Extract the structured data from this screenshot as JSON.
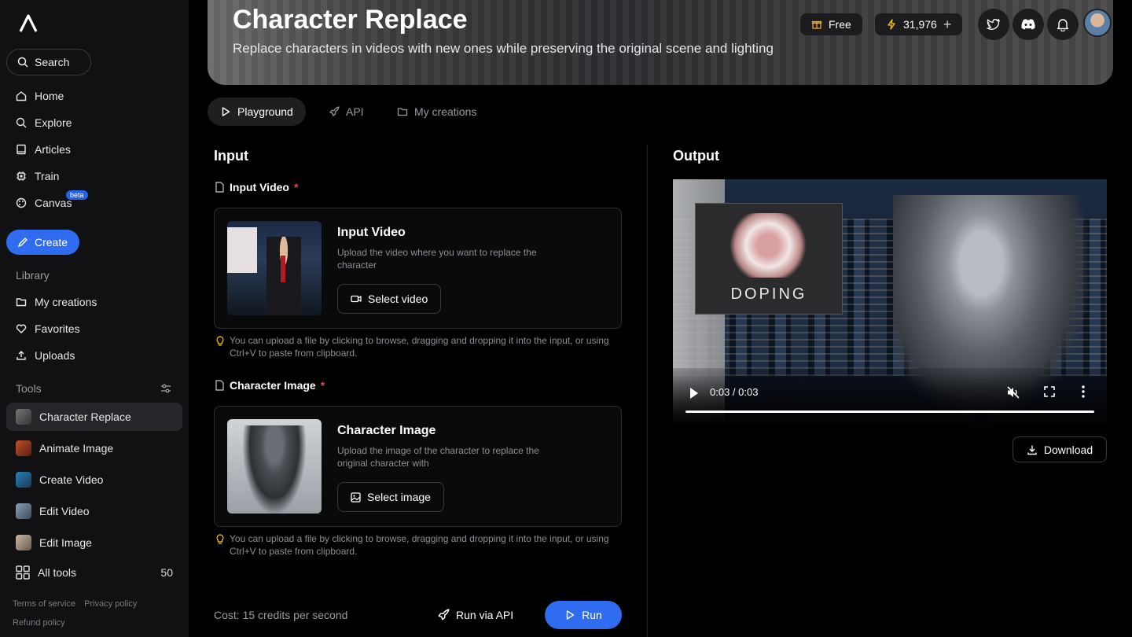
{
  "sidebar": {
    "search_label": "Search",
    "nav": [
      {
        "label": "Home",
        "icon": "home-icon"
      },
      {
        "label": "Explore",
        "icon": "search-icon"
      },
      {
        "label": "Articles",
        "icon": "book-icon"
      },
      {
        "label": "Train",
        "icon": "chip-icon"
      },
      {
        "label": "Canvas",
        "icon": "palette-icon"
      }
    ],
    "canvas_badge": "beta",
    "create_label": "Create",
    "library_label": "Library",
    "library": [
      {
        "label": "My creations",
        "icon": "folder-icon"
      },
      {
        "label": "Favorites",
        "icon": "heart-icon"
      },
      {
        "label": "Uploads",
        "icon": "upload-icon"
      }
    ],
    "tools_label": "Tools",
    "tools": [
      {
        "label": "Character Replace",
        "active": true
      },
      {
        "label": "Animate Image",
        "active": false
      },
      {
        "label": "Create Video",
        "active": false
      },
      {
        "label": "Edit Video",
        "active": false
      },
      {
        "label": "Edit Image",
        "active": false
      }
    ],
    "all_tools_label": "All tools",
    "all_tools_count": "50",
    "footer": {
      "terms": "Terms of service",
      "privacy": "Privacy policy",
      "refund": "Refund policy"
    }
  },
  "header": {
    "title": "Character Replace",
    "subtitle": "Replace characters in videos with new ones while preserving the original scene and lighting",
    "plan_label": "Free",
    "credits": "31,976",
    "credits_add": "+"
  },
  "tabs": [
    {
      "label": "Playground",
      "active": true
    },
    {
      "label": "API",
      "active": false
    },
    {
      "label": "My creations",
      "active": false
    }
  ],
  "input": {
    "heading": "Input",
    "video_field": {
      "label": "Input Video",
      "required_mark": "*",
      "title": "Input Video",
      "desc": "Upload the video where you want to replace the character",
      "button": "Select video"
    },
    "image_field": {
      "label": "Character Image",
      "required_mark": "*",
      "title": "Character Image",
      "desc": "Upload the image of the character to replace the original character with",
      "button": "Select image"
    },
    "hint": "You can upload a file by clicking to browse, dragging and dropping it into the input, or using Ctrl+V to paste from clipboard.",
    "cost": "Cost: 15 credits per second",
    "run_api_label": "Run via API",
    "run_label": "Run"
  },
  "output": {
    "heading": "Output",
    "video_time": "0:03 / 0:03",
    "video_progress": 1.0,
    "thumb_text": "DOPING",
    "download_label": "Download"
  },
  "colors": {
    "accent": "#2f6cf0",
    "required": "#ef4444",
    "sidebar_bg": "#111113"
  }
}
